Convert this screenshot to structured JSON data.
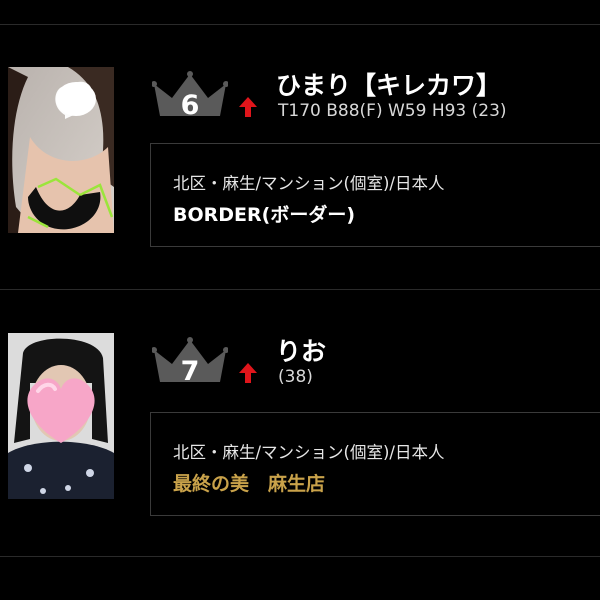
{
  "entries": [
    {
      "rank": "6",
      "name": "ひまり【キレカワ】",
      "stats": "T170 B88(F) W59 H93 (23)",
      "location": "北区・麻生/マンション(個室)/日本人",
      "shop": "BORDER(ボーダー)",
      "shop_color": "#ffffff",
      "trend": "up",
      "photo_icon": "white-heart-icon"
    },
    {
      "rank": "7",
      "name": "りお",
      "stats": "(38)",
      "location": "北区・麻生/マンション(個室)/日本人",
      "shop": "最終の美　麻生店",
      "shop_color": "#c9a24a",
      "trend": "up",
      "photo_icon": "pink-heart-icon"
    }
  ],
  "colors": {
    "background": "#000000",
    "crown": "#5a5a5a",
    "arrow": "#e0151b",
    "divider": "#2a2a2a"
  }
}
